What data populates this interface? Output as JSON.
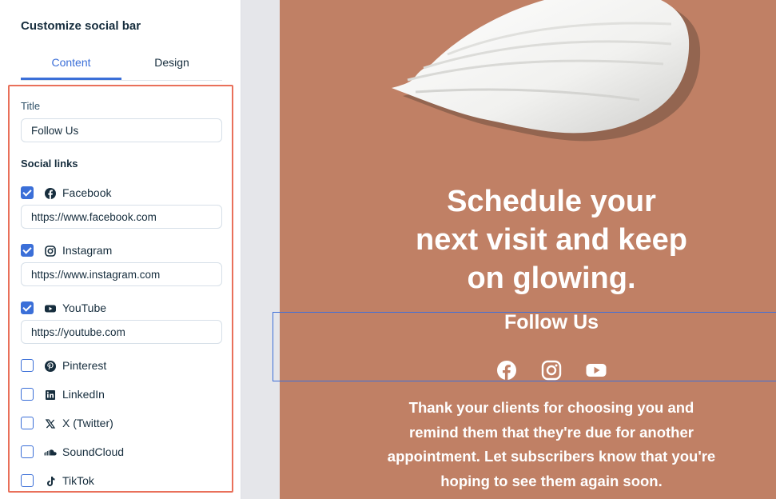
{
  "panel": {
    "title": "Customize social bar",
    "tabs": [
      {
        "label": "Content",
        "active": true
      },
      {
        "label": "Design",
        "active": false
      }
    ],
    "title_field": {
      "label": "Title",
      "value": "Follow Us"
    },
    "social_links_heading": "Social links",
    "links": [
      {
        "name": "Facebook",
        "icon": "facebook-icon",
        "checked": true,
        "url": "https://www.facebook.com"
      },
      {
        "name": "Instagram",
        "icon": "instagram-icon",
        "checked": true,
        "url": "https://www.instagram.com"
      },
      {
        "name": "YouTube",
        "icon": "youtube-icon",
        "checked": true,
        "url": "https://youtube.com"
      },
      {
        "name": "Pinterest",
        "icon": "pinterest-icon",
        "checked": false
      },
      {
        "name": "LinkedIn",
        "icon": "linkedin-icon",
        "checked": false
      },
      {
        "name": "X (Twitter)",
        "icon": "x-twitter-icon",
        "checked": false
      },
      {
        "name": "SoundCloud",
        "icon": "soundcloud-icon",
        "checked": false
      },
      {
        "name": "TikTok",
        "icon": "tiktok-icon",
        "checked": false
      }
    ]
  },
  "preview": {
    "headline_lines": [
      "Schedule your",
      "next visit and keep",
      "on glowing."
    ],
    "social_bar_title": "Follow Us",
    "social_icons": [
      "facebook-icon",
      "instagram-icon",
      "youtube-icon"
    ],
    "body_lines": [
      "Thank your clients for choosing you and",
      "remind them that they're due for another",
      "appointment. Let subscribers know that you're",
      "hoping to see them again soon."
    ]
  },
  "colors": {
    "accent": "#3b6fd8",
    "highlight": "#e9705a",
    "background_brand": "#c08065",
    "text_dark": "#162d3d"
  }
}
